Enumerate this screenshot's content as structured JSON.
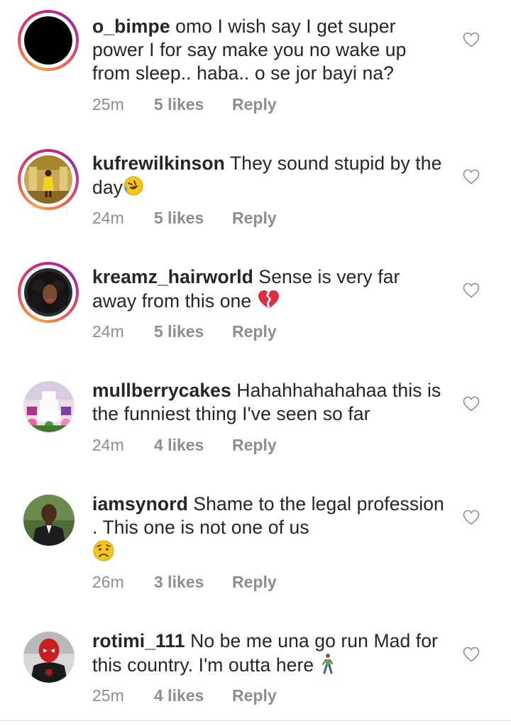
{
  "comments": [
    {
      "username": "o_bimpe",
      "text": "omo I wish say I get super power I for say  make you no wake up from sleep.. haba.. o se jor bayi na?",
      "time": "25m",
      "likes": "5 likes",
      "reply": "Reply",
      "avatar": "black-circle"
    },
    {
      "username": "kufrewilkinson",
      "text": "They sound stupid by the day",
      "emoji": "rofl-emoji",
      "time": "24m",
      "likes": "5 likes",
      "reply": "Reply",
      "avatar": "person-in-gold-room"
    },
    {
      "username": "kreamz_hairworld",
      "text": "Sense is very far away from this one",
      "emoji": "broken-heart-emoji",
      "time": "24m",
      "likes": "5 likes",
      "reply": "Reply",
      "avatar": "woman-curly-hair"
    },
    {
      "username": "mullberrycakes",
      "text": "Hahahhahahahaa this is the funniest thing I've seen so far",
      "time": "24m",
      "likes": "4 likes",
      "reply": "Reply",
      "avatar": "wedding-cake"
    },
    {
      "username": "iamsynord",
      "text": "Shame to the legal profession . This one is not one of us",
      "emoji": "sad-face-emoji",
      "time": "26m",
      "likes": "3 likes",
      "reply": "Reply",
      "avatar": "man-in-suit"
    },
    {
      "username": "rotimi_111",
      "text": "No be me una go run Mad for this country. I'm outta here",
      "emoji": "person-walking-emoji",
      "time": "25m",
      "likes": "4 likes",
      "reply": "Reply",
      "avatar": "spiderman-mask"
    }
  ],
  "colors": {
    "text": "#262626",
    "meta": "#8e8e8e",
    "story_ring_start": "#f9a03a",
    "story_ring_end": "#c9247f"
  }
}
